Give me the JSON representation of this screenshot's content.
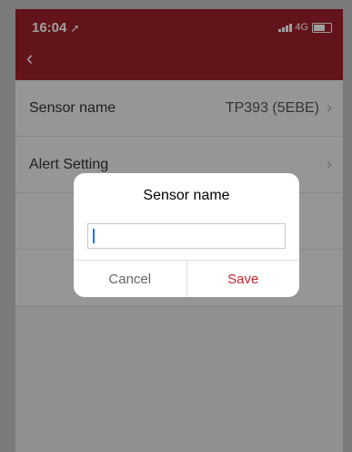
{
  "status": {
    "time": "16:04",
    "network": "4G"
  },
  "list": [
    {
      "label": "Sensor name",
      "value": "TP393 (5EBE)"
    },
    {
      "label": "Alert Setting",
      "value": ""
    }
  ],
  "dialog": {
    "title": "Sensor name",
    "input_value": "",
    "cancel_label": "Cancel",
    "save_label": "Save"
  },
  "colors": {
    "header": "#a11f2a",
    "save": "#c4262f"
  },
  "icons": {
    "back": "chevron-left-icon",
    "row_chevron": "chevron-right-icon",
    "location": "location-arrow-icon"
  }
}
